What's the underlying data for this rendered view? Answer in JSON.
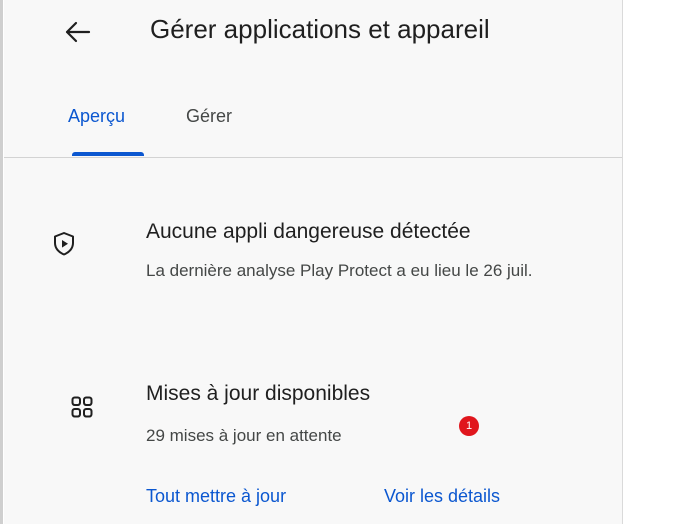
{
  "header": {
    "back_icon": "arrow-left-icon",
    "title": "Gérer applications et appareil"
  },
  "tabs": [
    {
      "label": "Aperçu",
      "active": true
    },
    {
      "label": "Gérer",
      "active": false
    }
  ],
  "colors": {
    "accent": "#0b57d0",
    "badge": "#e0161d",
    "text_primary": "#1f1f1f",
    "text_secondary": "#444746"
  },
  "protect": {
    "icon": "play-protect-shield-icon",
    "title": "Aucune appli dangereuse détectée",
    "subtitle": "La dernière analyse Play Protect a eu lieu le 26 juil."
  },
  "updates": {
    "icon": "apps-grid-icon",
    "title": "Mises à jour disponibles",
    "subtitle": "29 mises à jour en attente",
    "badge": "1",
    "update_all_label": "Tout mettre à jour",
    "details_label": "Voir les détails"
  }
}
